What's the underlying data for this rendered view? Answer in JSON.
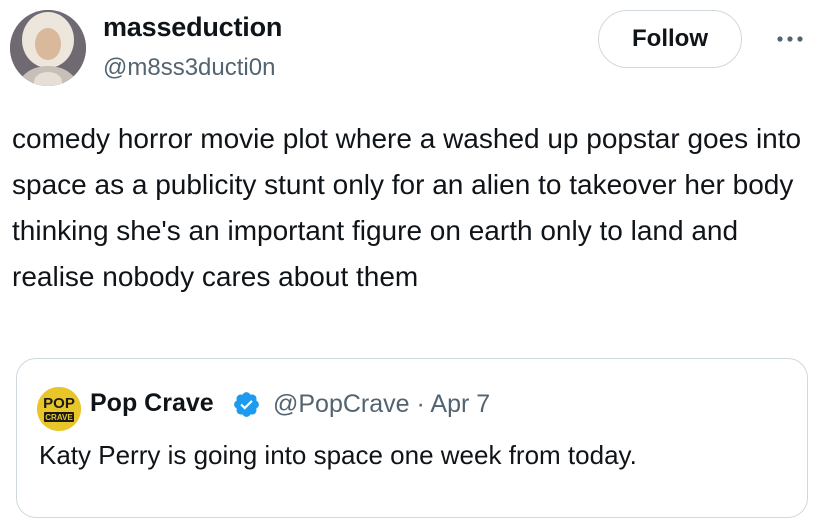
{
  "author": {
    "display_name": "masseduction",
    "handle": "@m8ss3ducti0n"
  },
  "actions": {
    "follow_label": "Follow",
    "more_icon": "more-horizontal-icon"
  },
  "tweet": {
    "text": "comedy horror movie plot where a washed up popstar goes into space as a publicity stunt only for an alien to takeover her body thinking she's an important figure on earth only to land and realise nobody cares about them"
  },
  "quoted_tweet": {
    "display_name": "Pop Crave",
    "handle": "@PopCrave",
    "separator": "·",
    "date": "Apr 7",
    "text": "Katy Perry is going into space one week from today.",
    "verified_icon": "verified-badge-icon",
    "avatar_text_top": "POP",
    "avatar_text_bottom": "CRAVE",
    "colors": {
      "verified": "#1d9bf0",
      "avatar_bg": "#e8c62a"
    }
  }
}
